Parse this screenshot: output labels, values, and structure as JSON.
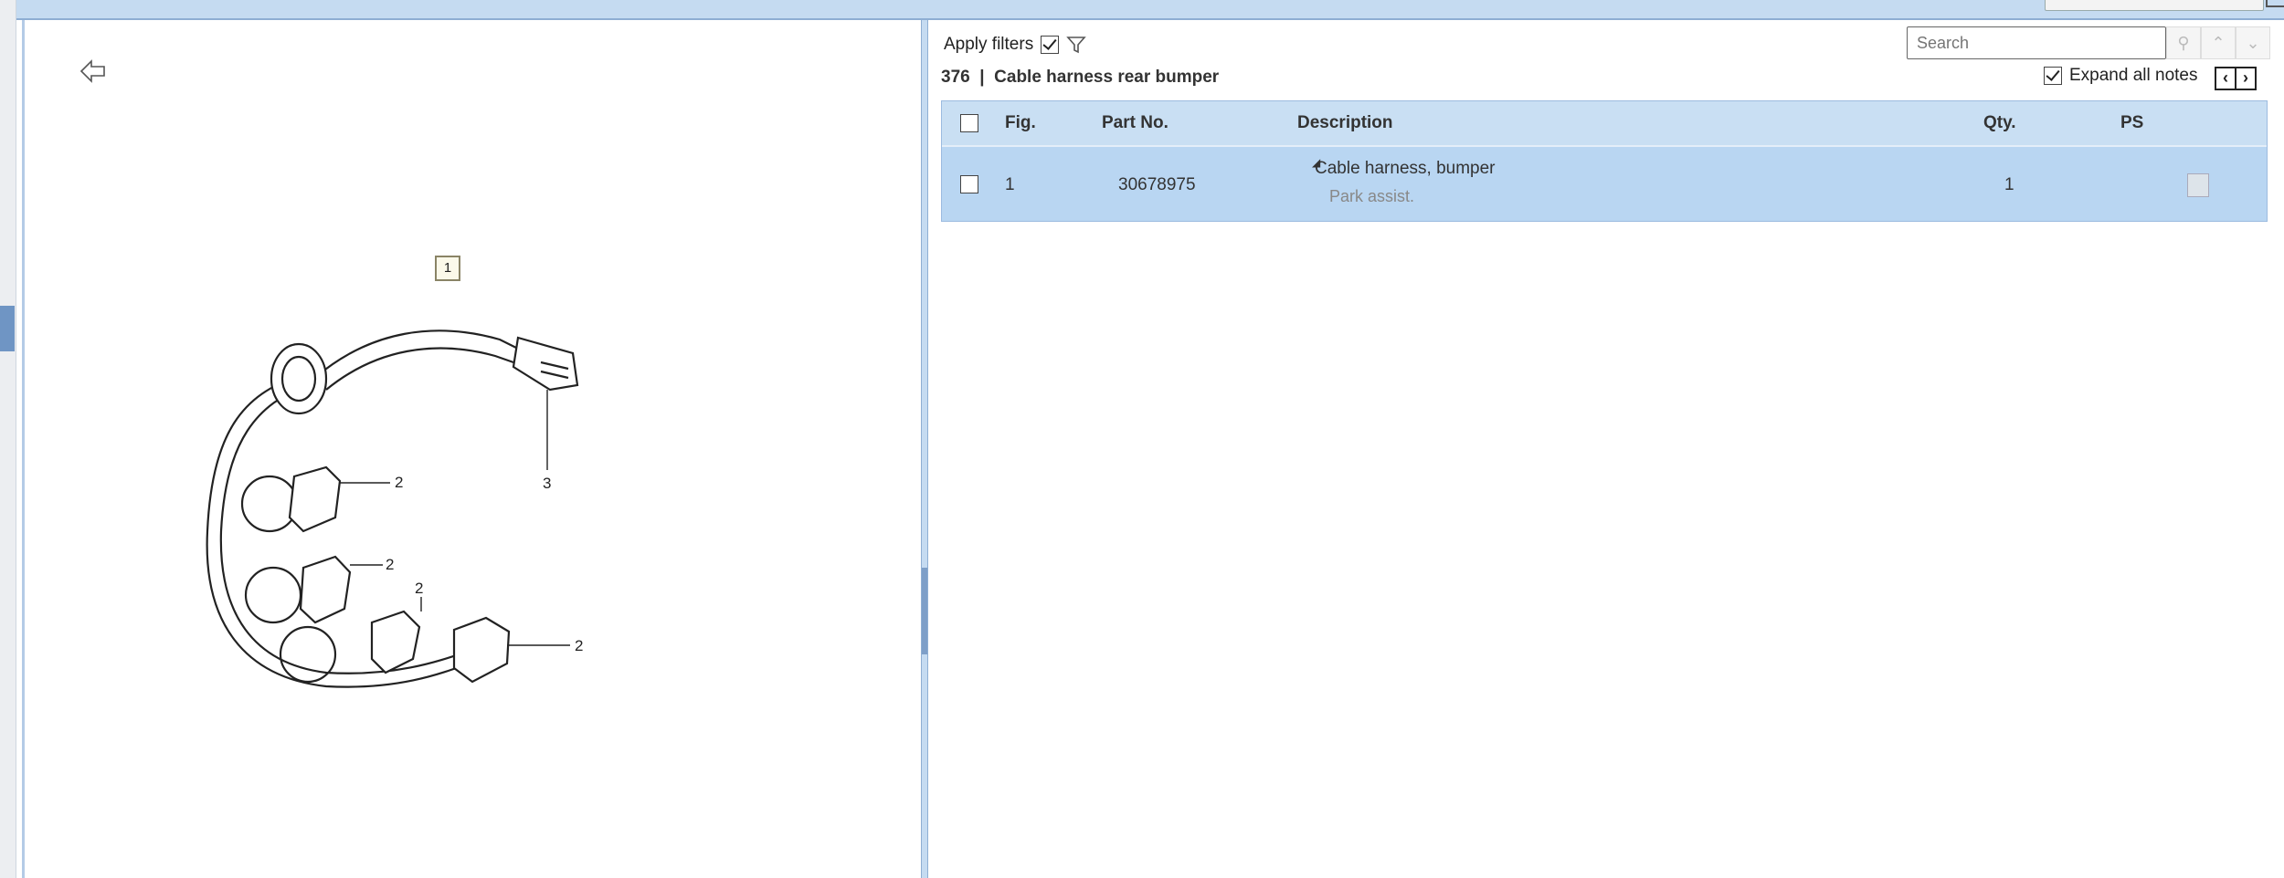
{
  "filters": {
    "apply_label": "Apply filters",
    "apply_checked": true
  },
  "header": {
    "number": "376",
    "separator": "|",
    "title": "Cable harness rear bumper"
  },
  "search": {
    "placeholder": "Search"
  },
  "expand": {
    "label": "Expand all notes",
    "checked": true
  },
  "table": {
    "columns": [
      "Fig.",
      "Part No.",
      "Description",
      "Qty.",
      "PS"
    ],
    "rows": [
      {
        "fig": "1",
        "part_no": "30678975",
        "description": "Cable harness, bumper",
        "note": "Park assist.",
        "qty": "1",
        "ps": ""
      }
    ]
  },
  "illustration": {
    "group_label": "1",
    "callouts": [
      "2",
      "2",
      "2",
      "2",
      "3"
    ]
  },
  "colors": {
    "panel_blue": "#c5dbf1",
    "row_selected": "#b9d6f2"
  }
}
